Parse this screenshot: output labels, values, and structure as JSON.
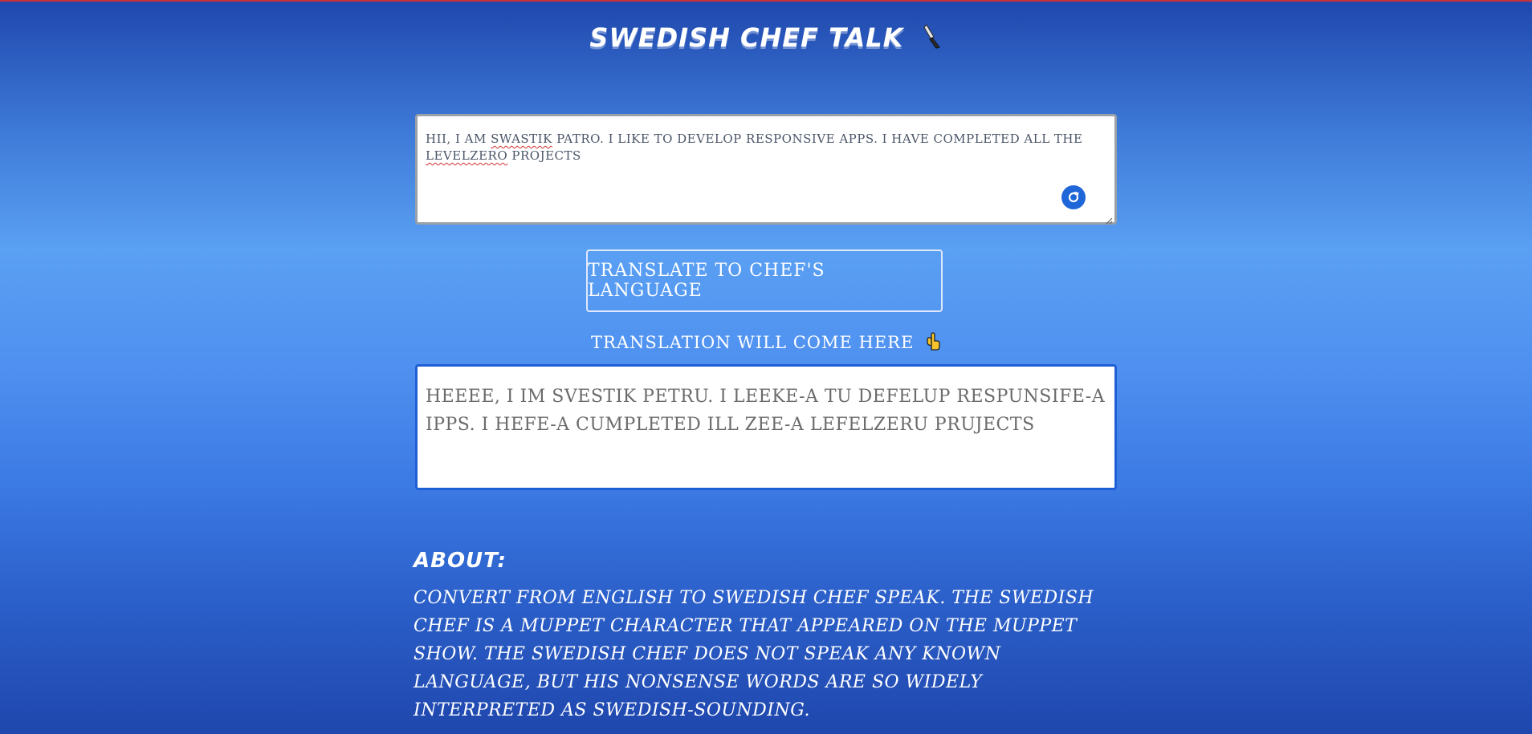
{
  "header": {
    "title": "SWEDISH CHEF TALK",
    "icon": "knife-icon"
  },
  "input": {
    "value_parts": [
      "HII, I AM ",
      "SWASTIK",
      " PATRO. I LIKE TO DEVELOP RESPONSIVE APPS. I HAVE COMPLETED ALL THE ",
      "LEVELZERO",
      " PROJECTS"
    ],
    "refresh_icon": "refresh-icon"
  },
  "translate_button": {
    "label": "TRANSLATE TO CHEF'S LANGUAGE"
  },
  "output": {
    "label": "TRANSLATION WILL COME HERE",
    "label_icon": "pointing-down-hand-icon",
    "value": "HEEEE, I IM SVESTIK PETRU. I LEEKE-A TU DEFELUP RESPUNSIFE-A IPPS. I HEFE-A CUMPLETED ILL ZEE-A LEFELZERU PRUJECTS"
  },
  "about": {
    "title": "ABOUT:",
    "text": "CONVERT FROM ENGLISH TO SWEDISH CHEF SPEAK. THE SWEDISH CHEF IS A MUPPET CHARACTER THAT APPEARED ON THE MUPPET SHOW. THE SWEDISH CHEF DOES NOT SPEAK ANY KNOWN LANGUAGE, BUT HIS NONSENSE WORDS ARE SO WIDELY INTERPRETED AS SWEDISH-SOUNDING."
  },
  "colors": {
    "accent": "#1f66d9",
    "background_top": "#1f47ad",
    "background_mid": "#5aa0f3"
  }
}
